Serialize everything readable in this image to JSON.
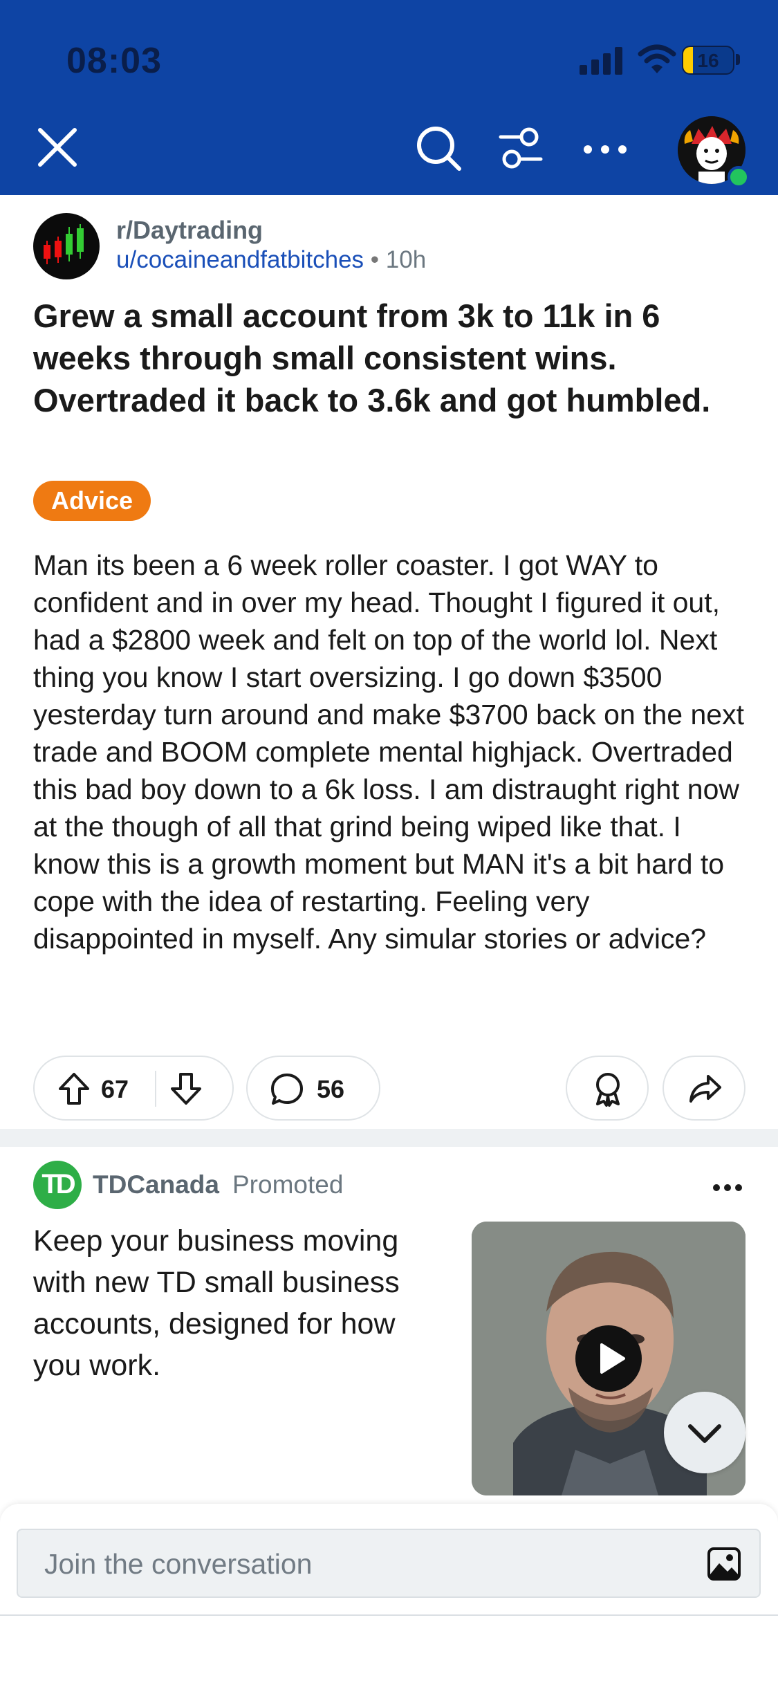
{
  "status_bar": {
    "time": "08:03",
    "battery": "16"
  },
  "header": {
    "close_icon": "close-icon",
    "search_icon": "search-icon",
    "filter_icon": "filter-icon",
    "more_icon": "more-horizontal-icon",
    "accent": "#0e44a4"
  },
  "post": {
    "subreddit": "r/Daytrading",
    "author": "u/cocaineandfatbitches",
    "separator": "•",
    "age": "10h",
    "title": "Grew a small account from 3k to 11k in 6 weeks through small consistent wins. Overtraded it back to 3.6k and got humbled.",
    "flair": "Advice",
    "flair_color": "#ef7a12",
    "body": "Man its been a 6 week roller coaster. I got WAY to confident and in over my head. Thought I figured it out, had a $2800 week and felt on top of the world lol. Next thing you know I start oversizing. I go down $3500 yesterday turn around and make $3700 back on the next trade and BOOM complete mental highjack. Overtraded this bad boy down to a 6k loss. I am distraught right now at the though of all that grind being wiped like that. I know this is a growth moment but MAN it's a bit hard to cope with the idea of restarting. Feeling very disappointed in myself. Any simular stories or advice?",
    "upvotes": "67",
    "comments": "56"
  },
  "promoted": {
    "advertiser": "TDCanada",
    "label": "Promoted",
    "logo_text": "TD",
    "text": "Keep your business moving with new TD small business accounts, designed for how you work."
  },
  "composer": {
    "placeholder": "Join the conversation"
  }
}
